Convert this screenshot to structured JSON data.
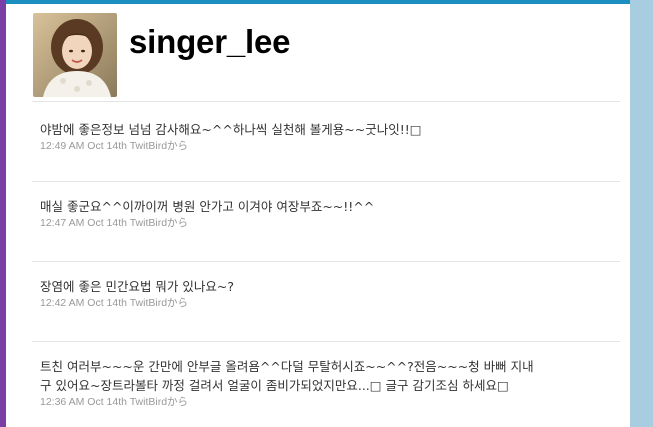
{
  "colors": {
    "top_bar": "#1a8fc0",
    "left_strip": "#7a3fa6",
    "right_strip": "#a9cde0",
    "username": "#000000",
    "tweet_text": "#333333",
    "meta_text": "#999999",
    "divider": "#e4e4e4"
  },
  "profile": {
    "username": "singer_lee",
    "avatar_icon": "profile-photo"
  },
  "tweets": [
    {
      "text": "야밤에 좋은정보 넘넘 감사해요~^^하나씩 실천해 볼게용~~굿나잇!!□",
      "time": "12:49 AM Oct 14th",
      "source": "TwitBirdから"
    },
    {
      "text": "매실 좋군요^^이까이꺼 병원 안가고 이겨야 여장부죠~~!!^^",
      "time": "12:47 AM Oct 14th",
      "source": "TwitBirdから"
    },
    {
      "text": "장염에 좋은 민간요법 뭐가 있나요~?",
      "time": "12:42 AM Oct 14th",
      "source": "TwitBirdから"
    },
    {
      "text": "트친 여러부~~~운 간만에 안부글 올려욤^^다덜 무탈허시죠~~^^?전음~~~청 바뻐 지내구 있어요~장트라볼타 까정 걸려서 얼굴이 좀비가되었지만요...□ 글구 감기조심 하세요□",
      "time": "12:36 AM Oct 14th",
      "source": "TwitBirdから"
    }
  ]
}
